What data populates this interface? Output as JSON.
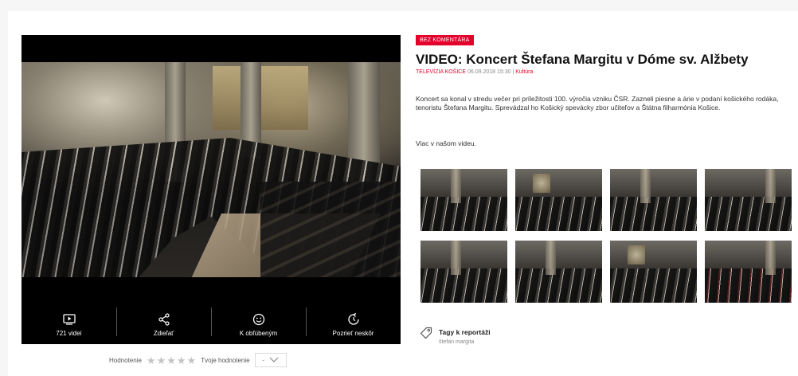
{
  "player": {
    "controls": [
      {
        "icon": "play-screen-icon",
        "label": "721 videí"
      },
      {
        "icon": "share-icon",
        "label": "Zdieľať"
      },
      {
        "icon": "smiley-icon",
        "label": "K obľúbeným"
      },
      {
        "icon": "replay-icon",
        "label": "Pozrieť neskôr"
      }
    ]
  },
  "rating": {
    "label": "Hodnotenie",
    "stars_filled": 0,
    "stars_total": 5,
    "my_label": "Tvoje hodnotenie",
    "my_value": "-"
  },
  "article": {
    "badge": "BEZ KOMENTÁRA",
    "title": "VIDEO: Koncert Štefana Margitu v Dóme sv. Alžbety",
    "source": "TELEVÍZIA KOŠICE",
    "date": "06.09.2018 15:30",
    "separator": "|",
    "category": "Kultúra",
    "description": "Koncert sa konal v stredu večer pri príležitosti 100. výročia vzniku ČSR. Zazneli piesne a árie v podaní košického rodáka, tenoristu Štefana Margitu. Sprevádzal ho Košický spevácky zbor učiteľov a Štátna filharmónia Košice.",
    "more": "Viac v našom videu."
  },
  "gallery": {
    "count": 8
  },
  "tags": {
    "title": "Tagy k reportáži",
    "items": [
      "štefan margita"
    ]
  },
  "colors": {
    "accent": "#e4002b",
    "player_bg": "#000000"
  }
}
